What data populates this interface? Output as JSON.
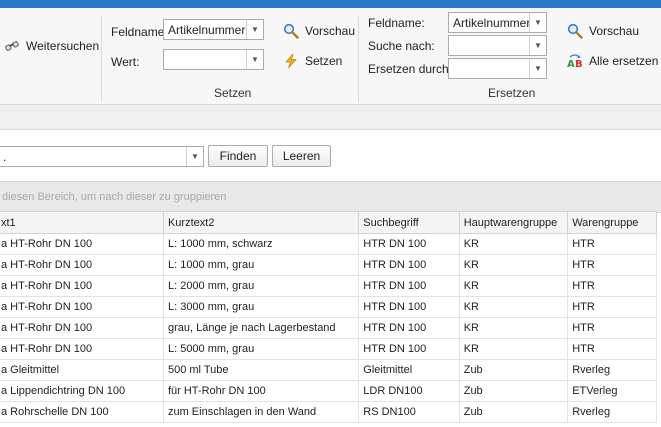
{
  "ribbon": {
    "weitersuchen_label": "Weitersuchen",
    "setzen_group": {
      "feldname_label": "Feldname:",
      "feldname_value": "Artikelnummer",
      "wert_label": "Wert:",
      "wert_value": "",
      "vorschau_label": "Vorschau",
      "setzen_label": "Setzen",
      "group_label": "Setzen"
    },
    "ersetzen_group": {
      "feldname_label": "Feldname:",
      "feldname_value": "Artikelnummer",
      "suche_nach_label": "Suche nach:",
      "suche_nach_value": "",
      "ersetzen_durch_label": "Ersetzen durch:",
      "ersetzen_durch_value": "",
      "vorschau_label": "Vorschau",
      "alle_ersetzen_label": "Alle ersetzen",
      "group_label": "Ersetzen"
    }
  },
  "search": {
    "value": ".",
    "finden_label": "Finden",
    "leeren_label": "Leeren"
  },
  "group_panel_hint": "diesen Bereich, um nach dieser zu gruppieren",
  "grid": {
    "columns": [
      "xt1",
      "Kurztext2",
      "Suchbegriff",
      "Hauptwarengruppe",
      "Warengruppe"
    ],
    "rows": [
      [
        "a HT-Rohr DN 100",
        "L: 1000 mm, schwarz",
        "HTR DN 100",
        "KR",
        "HTR"
      ],
      [
        "a HT-Rohr DN 100",
        "L: 1000 mm, grau",
        "HTR DN 100",
        "KR",
        "HTR"
      ],
      [
        "a HT-Rohr DN 100",
        "L: 2000 mm, grau",
        "HTR DN 100",
        "KR",
        "HTR"
      ],
      [
        "a HT-Rohr DN 100",
        "L: 3000 mm, grau",
        "HTR DN 100",
        "KR",
        "HTR"
      ],
      [
        "a HT-Rohr DN 100",
        "grau, Länge je nach Lagerbestand",
        "HTR DN 100",
        "KR",
        "HTR"
      ],
      [
        "a HT-Rohr DN 100",
        "L: 5000 mm, grau",
        "HTR DN 100",
        "KR",
        "HTR"
      ],
      [
        "a Gleitmittel",
        "500 ml Tube",
        "Gleitmittel",
        "Zub",
        "Rverleg"
      ],
      [
        "a Lippendichtring DN 100",
        "für HT-Rohr DN 100",
        "LDR DN100",
        "Zub",
        "ETVerleg"
      ],
      [
        "a Rohrschelle DN 100",
        "zum Einschlagen in den Wand",
        "RS DN100",
        "Zub",
        "Rverleg"
      ]
    ]
  },
  "colors": {
    "title_bar": "#2b78c9",
    "ribbon_bg": "#f7f7f7",
    "group_panel_bg": "#e8e8e8"
  }
}
